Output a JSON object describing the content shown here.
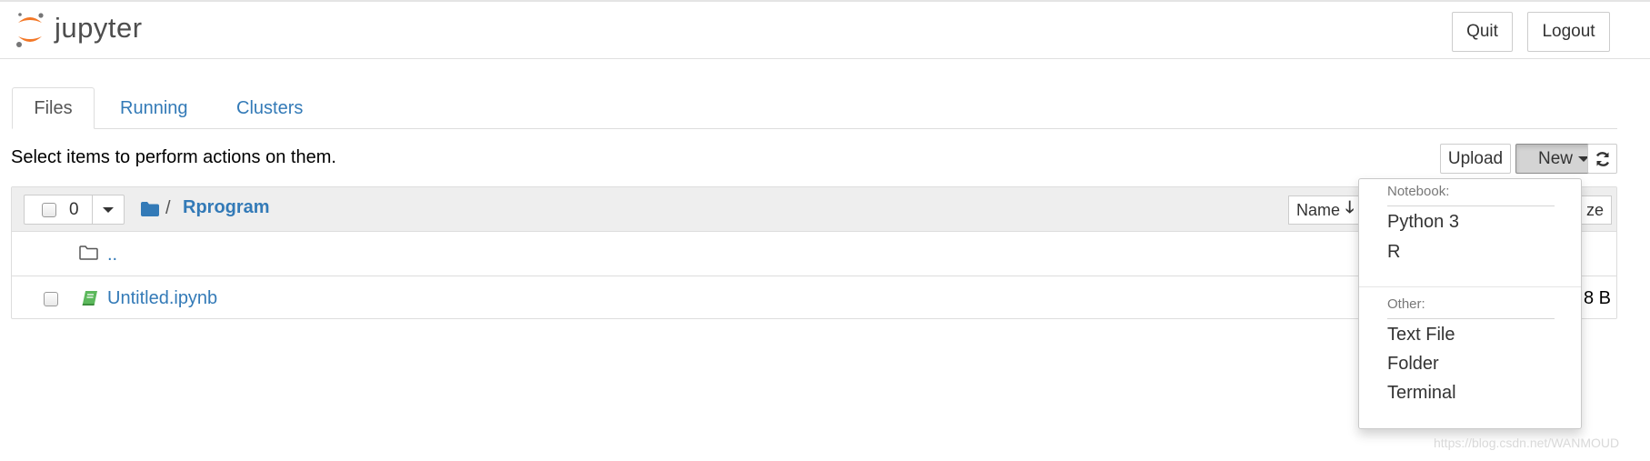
{
  "header": {
    "logo_text": "jupyter",
    "quit_label": "Quit",
    "logout_label": "Logout"
  },
  "tabs": [
    {
      "label": "Files",
      "active": true
    },
    {
      "label": "Running",
      "active": false
    },
    {
      "label": "Clusters",
      "active": false
    }
  ],
  "toolbar": {
    "message": "Select items to perform actions on them.",
    "upload_label": "Upload",
    "new_label": "New"
  },
  "file_list": {
    "selected_count": "0",
    "breadcrumb_separator": "/",
    "current_dir": "Rprogram",
    "sort_name_label": "Name",
    "sort_size_label": "ze",
    "parent_link": "..",
    "files": [
      {
        "name": "Untitled.ipynb",
        "size": "8 B",
        "type": "notebook"
      }
    ]
  },
  "new_menu": {
    "notebook_header": "Notebook:",
    "notebook_items": [
      "Python 3",
      "R"
    ],
    "other_header": "Other:",
    "other_items": [
      "Text File",
      "Folder",
      "Terminal"
    ]
  },
  "watermark": "https://blog.csdn.net/WANMOUD",
  "colors": {
    "link": "#337ab7",
    "logo_orange": "#f37726",
    "logo_gray": "#767677",
    "notebook_icon": "#5cb85c"
  },
  "icons": [
    "jupyter-logo",
    "caret-down-icon",
    "refresh-icon",
    "folder-icon",
    "folder-open-icon",
    "notebook-icon",
    "sort-down-arrow-icon"
  ]
}
